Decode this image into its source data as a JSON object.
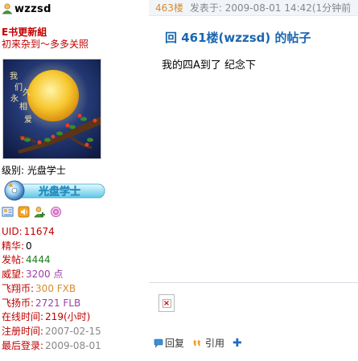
{
  "profile": {
    "username": "wzzsd",
    "group_title": "E书更新組",
    "signature": "初来杂到～多多关照",
    "avatar_text": [
      "我们永久相爱"
    ],
    "rank_label": "级别: 光盘学士",
    "rank_badge_text": "光盘学士",
    "stats": [
      {
        "label": "UID:",
        "value": "11674",
        "color": "#c20000"
      },
      {
        "label": "精华:",
        "value": "0",
        "color": "#000000"
      },
      {
        "label": "发帖:",
        "value": "4444",
        "color": "#1f7b1f"
      },
      {
        "label": "威望:",
        "value": "3200 点",
        "color": "#9b3ea6"
      },
      {
        "label": "飞翔币:",
        "value": "300 FXB",
        "color": "#d98b2b"
      },
      {
        "label": "飞扬币:",
        "value": "2721 FLB",
        "color": "#9b3ea6"
      },
      {
        "label": "在线时间:",
        "value": "219(小时)",
        "color": "#c20000"
      },
      {
        "label": "注册时间:",
        "value": "2007-02-15",
        "color": "#878787"
      },
      {
        "label": "最后登录:",
        "value": "2009-08-01",
        "color": "#878787"
      }
    ],
    "icons": [
      "profile-card-icon",
      "speaker-icon",
      "add-friend-icon",
      "flower-icon"
    ]
  },
  "post": {
    "floor": "463楼",
    "time": "发表于: 2009-08-01 14:42(1分钟前",
    "title": "回  461楼(wzzsd) 的帖子",
    "body": "我的四A到了  纪念下",
    "actions": {
      "reply": "回复",
      "quote": "引用"
    }
  },
  "colors": {
    "title_blue": "#1a66b0",
    "label_red": "#c20000",
    "header_bg": "#f1f5fa"
  }
}
